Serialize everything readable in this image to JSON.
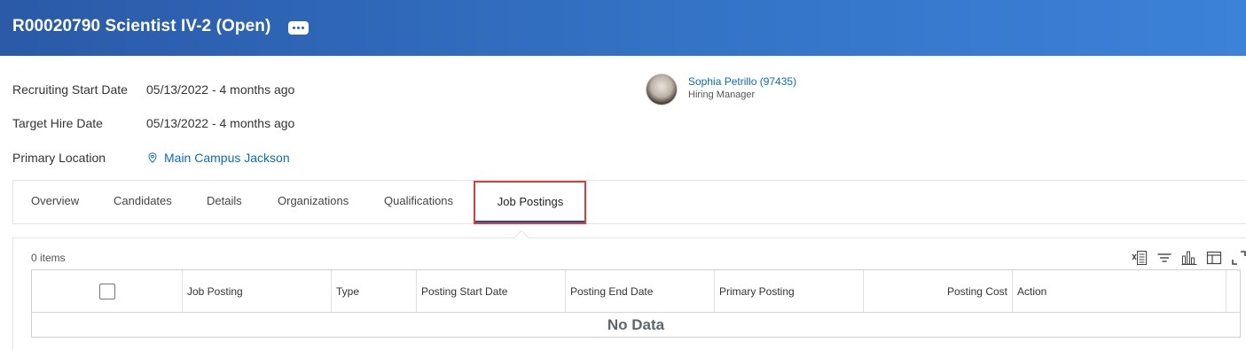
{
  "header": {
    "title": "R00020790 Scientist IV-2 (Open)",
    "more_icon": "ellipsis-icon",
    "colors": {
      "gradient_start": "#2a5aa8",
      "gradient_end": "#3b82d8"
    }
  },
  "summary": {
    "recruiting_start_label": "Recruiting Start Date",
    "recruiting_start_value": "05/13/2022 - 4 months ago",
    "target_hire_label": "Target Hire Date",
    "target_hire_value": "05/13/2022 - 4 months ago",
    "primary_location_label": "Primary Location",
    "primary_location_value": "Main Campus Jackson",
    "location_icon": "map-pin-icon"
  },
  "hiring_manager": {
    "name": "Sophia Petrillo (97435)",
    "role": "Hiring Manager"
  },
  "tabs": [
    {
      "label": "Overview",
      "active": false
    },
    {
      "label": "Candidates",
      "active": false
    },
    {
      "label": "Details",
      "active": false
    },
    {
      "label": "Organizations",
      "active": false
    },
    {
      "label": "Qualifications",
      "active": false
    },
    {
      "label": "Job Postings",
      "active": true
    }
  ],
  "table": {
    "items_count": "0 items",
    "toolbar_icons": [
      "export-excel-icon",
      "filter-icon",
      "chart-icon",
      "column-layout-icon",
      "fullscreen-icon"
    ],
    "columns": [
      "",
      "Job Posting",
      "Type",
      "Posting Start Date",
      "Posting End Date",
      "Primary Posting",
      "Posting Cost",
      "Action"
    ],
    "empty_message": "No Data"
  },
  "colors": {
    "link": "#0b6cbc",
    "active_tab_underline": "#1e4fa0",
    "highlight_box": "#e03b3b"
  }
}
